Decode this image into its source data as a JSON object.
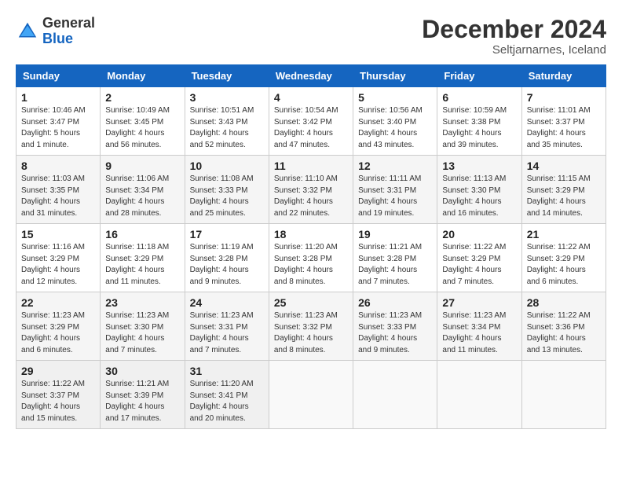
{
  "header": {
    "logo_line1": "General",
    "logo_line2": "Blue",
    "month_title": "December 2024",
    "location": "Seltjarnarnes, Iceland"
  },
  "weekdays": [
    "Sunday",
    "Monday",
    "Tuesday",
    "Wednesday",
    "Thursday",
    "Friday",
    "Saturday"
  ],
  "weeks": [
    [
      {
        "day": "1",
        "sunrise": "Sunrise: 10:46 AM",
        "sunset": "Sunset: 3:47 PM",
        "daylight": "Daylight: 5 hours and 1 minute."
      },
      {
        "day": "2",
        "sunrise": "Sunrise: 10:49 AM",
        "sunset": "Sunset: 3:45 PM",
        "daylight": "Daylight: 4 hours and 56 minutes."
      },
      {
        "day": "3",
        "sunrise": "Sunrise: 10:51 AM",
        "sunset": "Sunset: 3:43 PM",
        "daylight": "Daylight: 4 hours and 52 minutes."
      },
      {
        "day": "4",
        "sunrise": "Sunrise: 10:54 AM",
        "sunset": "Sunset: 3:42 PM",
        "daylight": "Daylight: 4 hours and 47 minutes."
      },
      {
        "day": "5",
        "sunrise": "Sunrise: 10:56 AM",
        "sunset": "Sunset: 3:40 PM",
        "daylight": "Daylight: 4 hours and 43 minutes."
      },
      {
        "day": "6",
        "sunrise": "Sunrise: 10:59 AM",
        "sunset": "Sunset: 3:38 PM",
        "daylight": "Daylight: 4 hours and 39 minutes."
      },
      {
        "day": "7",
        "sunrise": "Sunrise: 11:01 AM",
        "sunset": "Sunset: 3:37 PM",
        "daylight": "Daylight: 4 hours and 35 minutes."
      }
    ],
    [
      {
        "day": "8",
        "sunrise": "Sunrise: 11:03 AM",
        "sunset": "Sunset: 3:35 PM",
        "daylight": "Daylight: 4 hours and 31 minutes."
      },
      {
        "day": "9",
        "sunrise": "Sunrise: 11:06 AM",
        "sunset": "Sunset: 3:34 PM",
        "daylight": "Daylight: 4 hours and 28 minutes."
      },
      {
        "day": "10",
        "sunrise": "Sunrise: 11:08 AM",
        "sunset": "Sunset: 3:33 PM",
        "daylight": "Daylight: 4 hours and 25 minutes."
      },
      {
        "day": "11",
        "sunrise": "Sunrise: 11:10 AM",
        "sunset": "Sunset: 3:32 PM",
        "daylight": "Daylight: 4 hours and 22 minutes."
      },
      {
        "day": "12",
        "sunrise": "Sunrise: 11:11 AM",
        "sunset": "Sunset: 3:31 PM",
        "daylight": "Daylight: 4 hours and 19 minutes."
      },
      {
        "day": "13",
        "sunrise": "Sunrise: 11:13 AM",
        "sunset": "Sunset: 3:30 PM",
        "daylight": "Daylight: 4 hours and 16 minutes."
      },
      {
        "day": "14",
        "sunrise": "Sunrise: 11:15 AM",
        "sunset": "Sunset: 3:29 PM",
        "daylight": "Daylight: 4 hours and 14 minutes."
      }
    ],
    [
      {
        "day": "15",
        "sunrise": "Sunrise: 11:16 AM",
        "sunset": "Sunset: 3:29 PM",
        "daylight": "Daylight: 4 hours and 12 minutes."
      },
      {
        "day": "16",
        "sunrise": "Sunrise: 11:18 AM",
        "sunset": "Sunset: 3:29 PM",
        "daylight": "Daylight: 4 hours and 11 minutes."
      },
      {
        "day": "17",
        "sunrise": "Sunrise: 11:19 AM",
        "sunset": "Sunset: 3:28 PM",
        "daylight": "Daylight: 4 hours and 9 minutes."
      },
      {
        "day": "18",
        "sunrise": "Sunrise: 11:20 AM",
        "sunset": "Sunset: 3:28 PM",
        "daylight": "Daylight: 4 hours and 8 minutes."
      },
      {
        "day": "19",
        "sunrise": "Sunrise: 11:21 AM",
        "sunset": "Sunset: 3:28 PM",
        "daylight": "Daylight: 4 hours and 7 minutes."
      },
      {
        "day": "20",
        "sunrise": "Sunrise: 11:22 AM",
        "sunset": "Sunset: 3:29 PM",
        "daylight": "Daylight: 4 hours and 7 minutes."
      },
      {
        "day": "21",
        "sunrise": "Sunrise: 11:22 AM",
        "sunset": "Sunset: 3:29 PM",
        "daylight": "Daylight: 4 hours and 6 minutes."
      }
    ],
    [
      {
        "day": "22",
        "sunrise": "Sunrise: 11:23 AM",
        "sunset": "Sunset: 3:29 PM",
        "daylight": "Daylight: 4 hours and 6 minutes."
      },
      {
        "day": "23",
        "sunrise": "Sunrise: 11:23 AM",
        "sunset": "Sunset: 3:30 PM",
        "daylight": "Daylight: 4 hours and 7 minutes."
      },
      {
        "day": "24",
        "sunrise": "Sunrise: 11:23 AM",
        "sunset": "Sunset: 3:31 PM",
        "daylight": "Daylight: 4 hours and 7 minutes."
      },
      {
        "day": "25",
        "sunrise": "Sunrise: 11:23 AM",
        "sunset": "Sunset: 3:32 PM",
        "daylight": "Daylight: 4 hours and 8 minutes."
      },
      {
        "day": "26",
        "sunrise": "Sunrise: 11:23 AM",
        "sunset": "Sunset: 3:33 PM",
        "daylight": "Daylight: 4 hours and 9 minutes."
      },
      {
        "day": "27",
        "sunrise": "Sunrise: 11:23 AM",
        "sunset": "Sunset: 3:34 PM",
        "daylight": "Daylight: 4 hours and 11 minutes."
      },
      {
        "day": "28",
        "sunrise": "Sunrise: 11:22 AM",
        "sunset": "Sunset: 3:36 PM",
        "daylight": "Daylight: 4 hours and 13 minutes."
      }
    ],
    [
      {
        "day": "29",
        "sunrise": "Sunrise: 11:22 AM",
        "sunset": "Sunset: 3:37 PM",
        "daylight": "Daylight: 4 hours and 15 minutes."
      },
      {
        "day": "30",
        "sunrise": "Sunrise: 11:21 AM",
        "sunset": "Sunset: 3:39 PM",
        "daylight": "Daylight: 4 hours and 17 minutes."
      },
      {
        "day": "31",
        "sunrise": "Sunrise: 11:20 AM",
        "sunset": "Sunset: 3:41 PM",
        "daylight": "Daylight: 4 hours and 20 minutes."
      },
      null,
      null,
      null,
      null
    ]
  ]
}
